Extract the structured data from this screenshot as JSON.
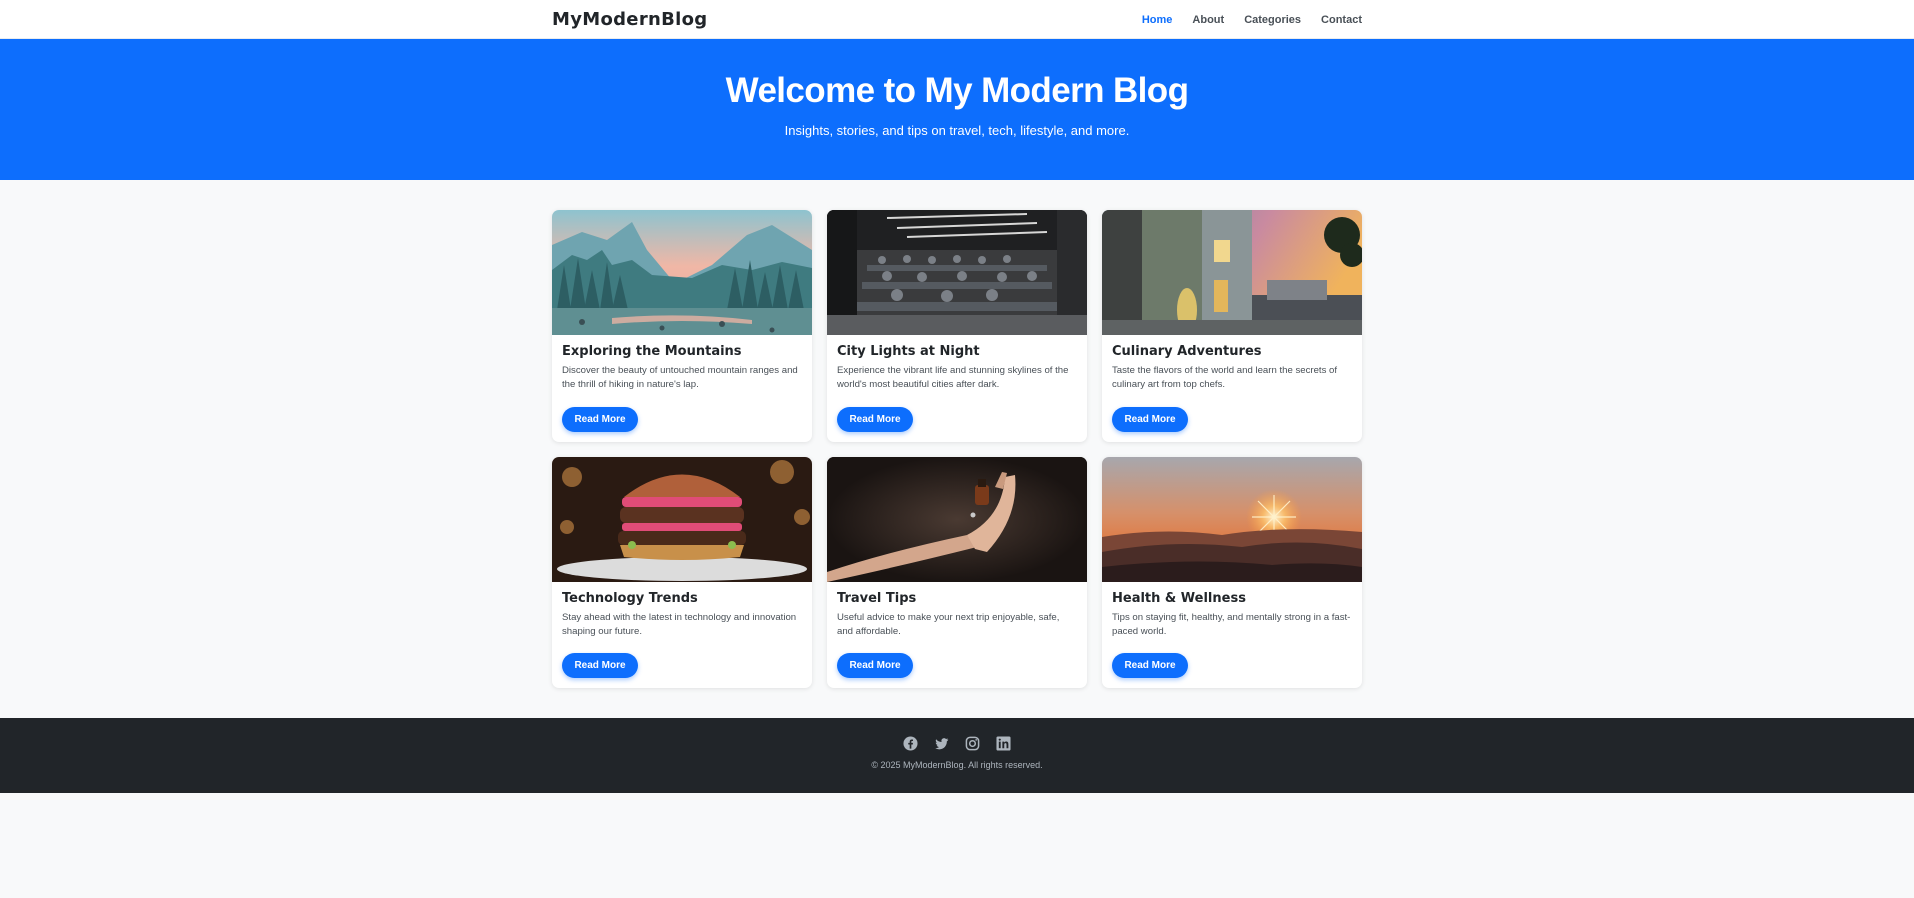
{
  "navbar": {
    "brand": "MyModernBlog",
    "links": [
      {
        "label": "Home",
        "active": true
      },
      {
        "label": "About"
      },
      {
        "label": "Categories"
      },
      {
        "label": "Contact"
      }
    ]
  },
  "hero": {
    "title": "Welcome to My Modern Blog",
    "subtitle": "Insights, stories, and tips on travel, tech, lifestyle, and more."
  },
  "posts": [
    {
      "title": "Exploring the Mountains",
      "text": "Discover the beauty of untouched mountain ranges and the thrill of hiking in nature's lap.",
      "button": "Read More",
      "image": "mountain-lake-image"
    },
    {
      "title": "City Lights at Night",
      "text": "Experience the vibrant life and stunning skylines of the world's most beautiful cities after dark.",
      "button": "Read More",
      "image": "office-room-image"
    },
    {
      "title": "Culinary Adventures",
      "text": "Taste the flavors of the world and learn the secrets of culinary art from top chefs.",
      "button": "Read More",
      "image": "modern-house-image"
    },
    {
      "title": "Technology Trends",
      "text": "Stay ahead with the latest in technology and innovation shaping our future.",
      "button": "Read More",
      "image": "burger-image"
    },
    {
      "title": "Travel Tips",
      "text": "Useful advice to make your next trip enjoyable, safe, and affordable.",
      "button": "Read More",
      "image": "hands-bottle-image"
    },
    {
      "title": "Health & Wellness",
      "text": "Tips on staying fit, healthy, and mentally strong in a fast-paced world.",
      "button": "Read More",
      "image": "sunset-hills-image"
    }
  ],
  "footer": {
    "socials": [
      "facebook-icon",
      "twitter-icon",
      "instagram-icon",
      "linkedin-icon"
    ],
    "copyright": "© 2025 MyModernBlog. All rights reserved."
  },
  "colors": {
    "primary": "#0d6efd",
    "footer_bg": "#212529",
    "page_bg": "#f8f9fa"
  }
}
